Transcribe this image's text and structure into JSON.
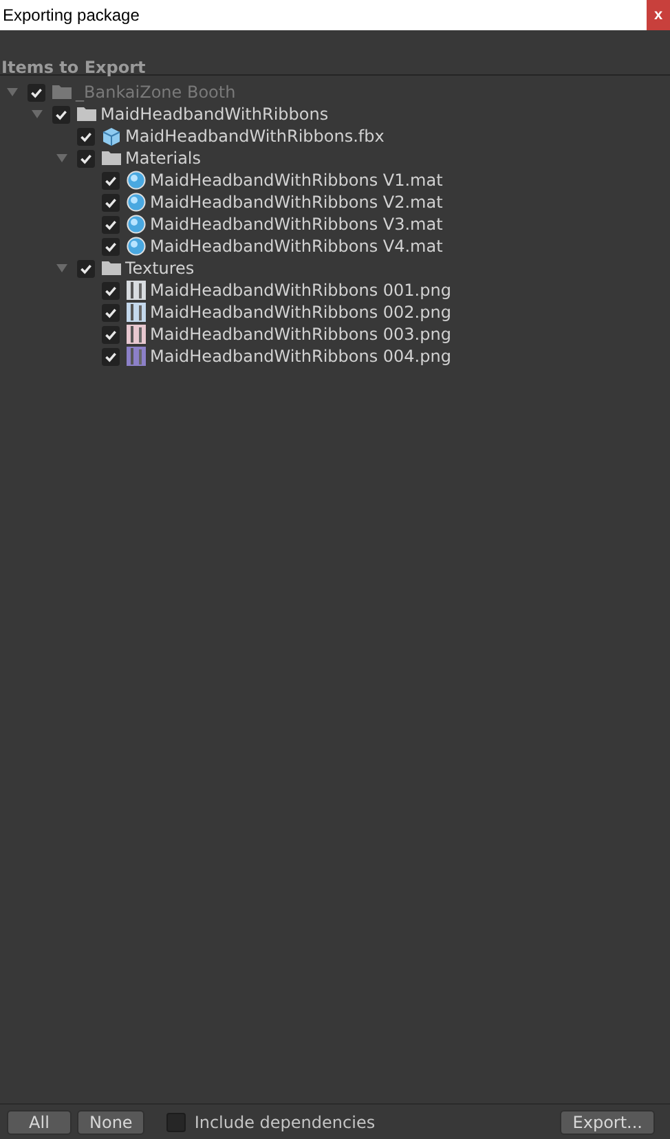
{
  "window": {
    "title": "Exporting package",
    "close": "x"
  },
  "header": "Items to Export",
  "tree": [
    {
      "label": "_BankaiZone Booth",
      "kind": "folder",
      "checked": true,
      "disabled": true,
      "expanded": true,
      "children": [
        {
          "label": "MaidHeadbandWithRibbons",
          "kind": "folder",
          "checked": true,
          "disabled": false,
          "expanded": true,
          "children": [
            {
              "label": "MaidHeadbandWithRibbons.fbx",
              "kind": "model",
              "checked": true,
              "disabled": false
            },
            {
              "label": "Materials",
              "kind": "folder",
              "checked": true,
              "disabled": false,
              "expanded": true,
              "children": [
                {
                  "label": "MaidHeadbandWithRibbons V1.mat",
                  "kind": "material",
                  "checked": true,
                  "disabled": false
                },
                {
                  "label": "MaidHeadbandWithRibbons V2.mat",
                  "kind": "material",
                  "checked": true,
                  "disabled": false
                },
                {
                  "label": "MaidHeadbandWithRibbons V3.mat",
                  "kind": "material",
                  "checked": true,
                  "disabled": false
                },
                {
                  "label": "MaidHeadbandWithRibbons V4.mat",
                  "kind": "material",
                  "checked": true,
                  "disabled": false
                }
              ]
            },
            {
              "label": "Textures",
              "kind": "folder",
              "checked": true,
              "disabled": false,
              "expanded": true,
              "children": [
                {
                  "label": "MaidHeadbandWithRibbons 001.png",
                  "kind": "texture",
                  "checked": true,
                  "disabled": false,
                  "color": "#d8dce0"
                },
                {
                  "label": "MaidHeadbandWithRibbons 002.png",
                  "kind": "texture",
                  "checked": true,
                  "disabled": false,
                  "color": "#c4d8ec"
                },
                {
                  "label": "MaidHeadbandWithRibbons 003.png",
                  "kind": "texture",
                  "checked": true,
                  "disabled": false,
                  "color": "#e8c8d0"
                },
                {
                  "label": "MaidHeadbandWithRibbons 004.png",
                  "kind": "texture",
                  "checked": true,
                  "disabled": false,
                  "color": "#8c80c8"
                }
              ]
            }
          ]
        }
      ]
    }
  ],
  "footer": {
    "all_button": "All",
    "none_button": "None",
    "include_dependencies": {
      "label": "Include dependencies",
      "checked": false
    },
    "export_button": "Export..."
  }
}
